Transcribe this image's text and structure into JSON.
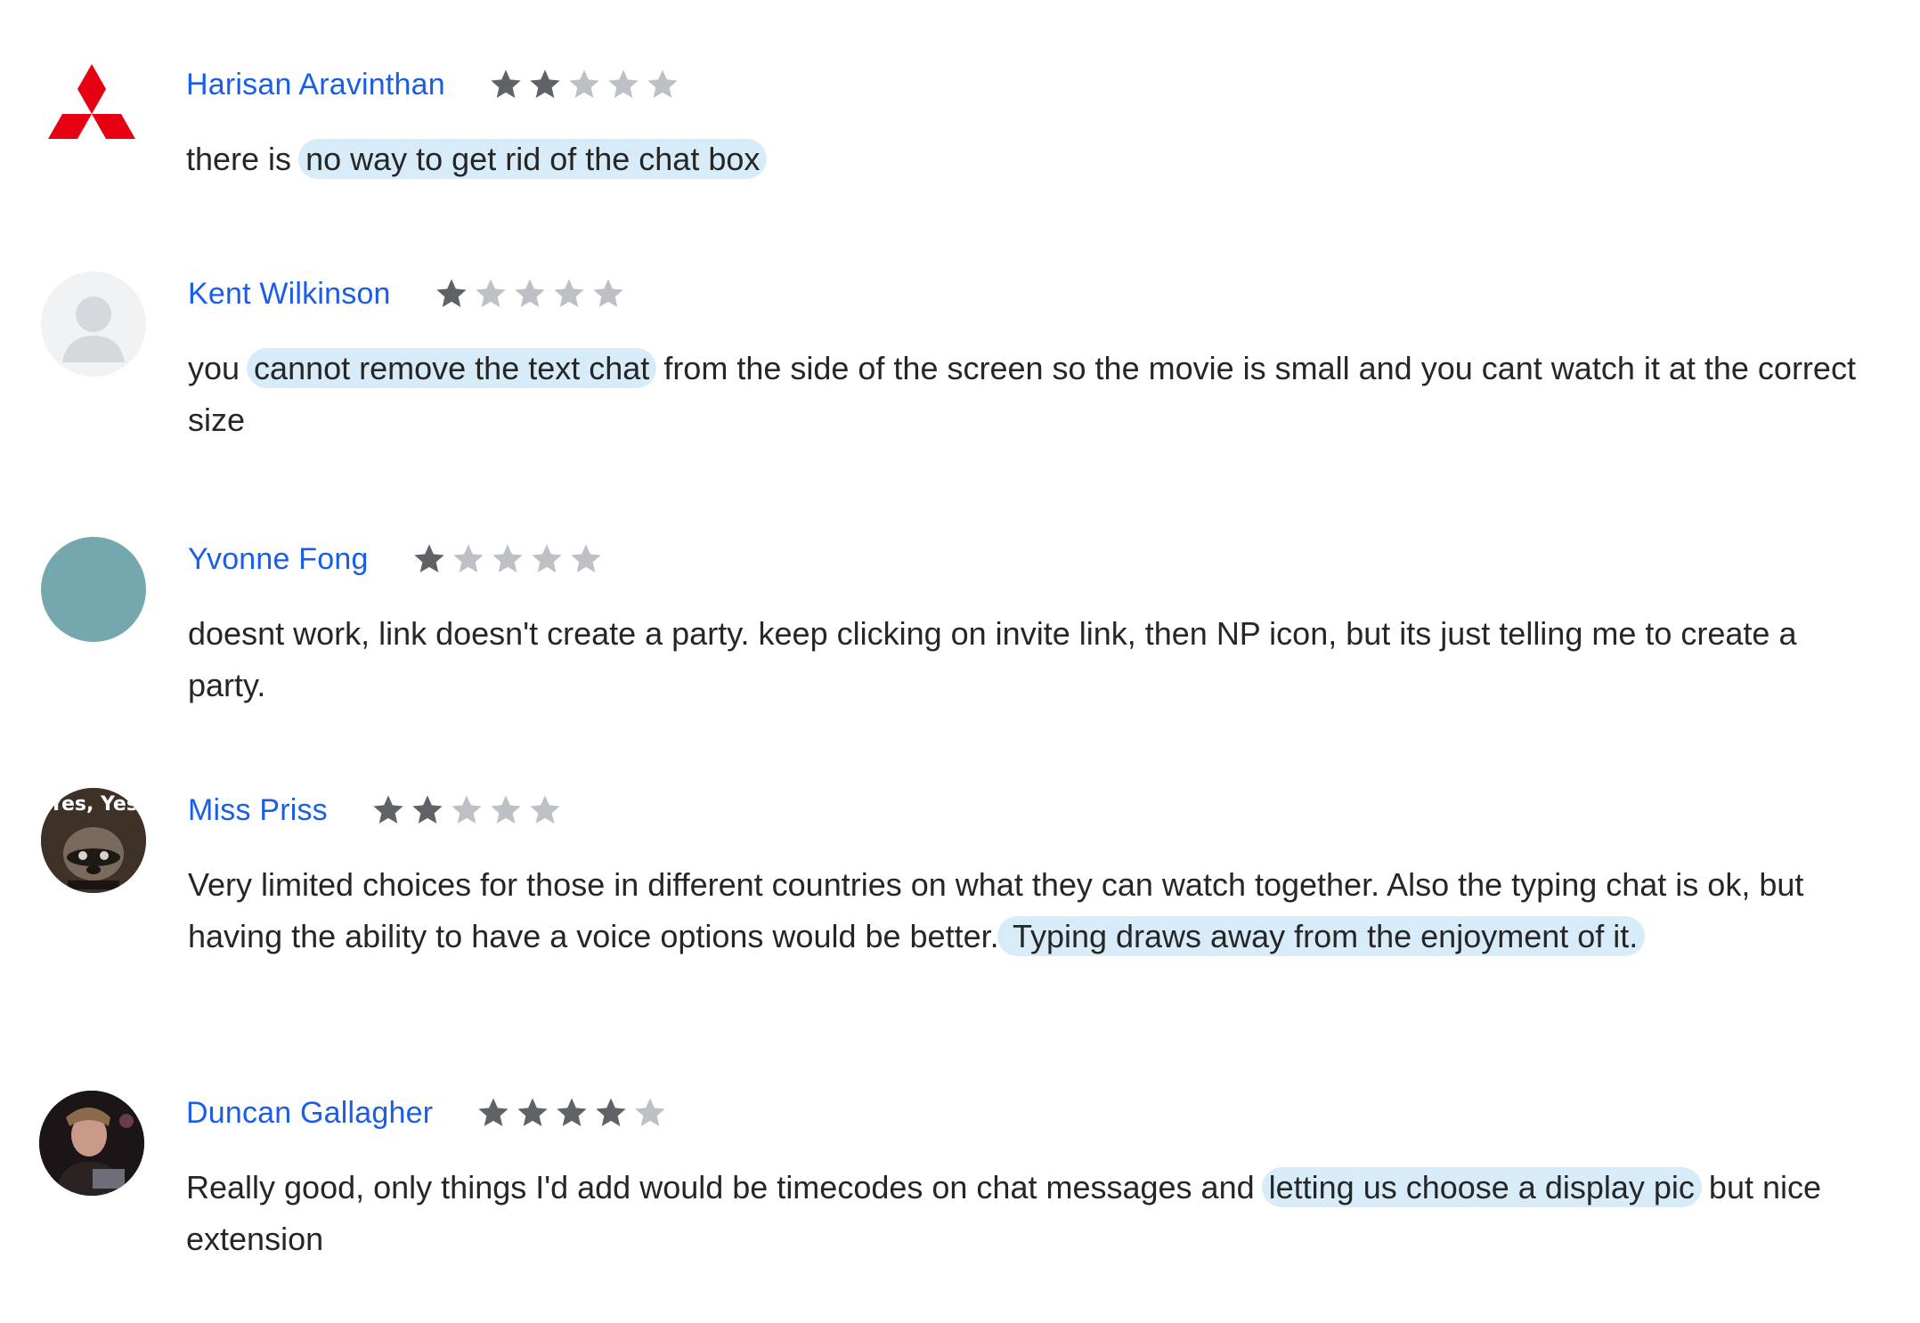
{
  "reviews": [
    {
      "author": "Harisan Aravinthan",
      "rating": 2,
      "max_rating": 5,
      "avatar": "mitsubishi-logo",
      "text_before": "there is ",
      "highlight": "no way to get rid of the chat box",
      "text_after": ""
    },
    {
      "author": "Kent Wilkinson",
      "rating": 1,
      "max_rating": 5,
      "avatar": "default-person-icon",
      "text_before": "you ",
      "highlight": "cannot remove the text chat",
      "text_after": " from the side of the screen so the movie is small and you cant watch it at the correct size"
    },
    {
      "author": "Yvonne Fong",
      "rating": 1,
      "max_rating": 5,
      "avatar": "teal-circle",
      "text_before": "doesnt work, link doesn't create a party. keep clicking on invite link, then NP icon, but its just telling me to create a party.",
      "highlight": "",
      "text_after": ""
    },
    {
      "author": "Miss Priss",
      "rating": 2,
      "max_rating": 5,
      "avatar": "raccoon-meme-photo",
      "avatar_text": "Yes, Yes",
      "text_before": "Very limited choices for those in different countries on what they can watch together. Also the typing chat is ok, but having the ability to have a voice options would be better.",
      "highlight": " Typing draws away from the enjoyment of it.",
      "text_after": ""
    },
    {
      "author": "Duncan Gallagher",
      "rating": 4,
      "max_rating": 5,
      "avatar": "profile-photo",
      "text_before": "Really good, only things I'd add would be timecodes on chat messages and ",
      "highlight": "letting us choose a display pic",
      "text_after": " but nice extension"
    }
  ],
  "colors": {
    "author": "#1a5ee8",
    "star_filled": "#5f6368",
    "star_empty": "#bdc1c6",
    "highlight": "#d7ecf8",
    "text": "#262626"
  }
}
